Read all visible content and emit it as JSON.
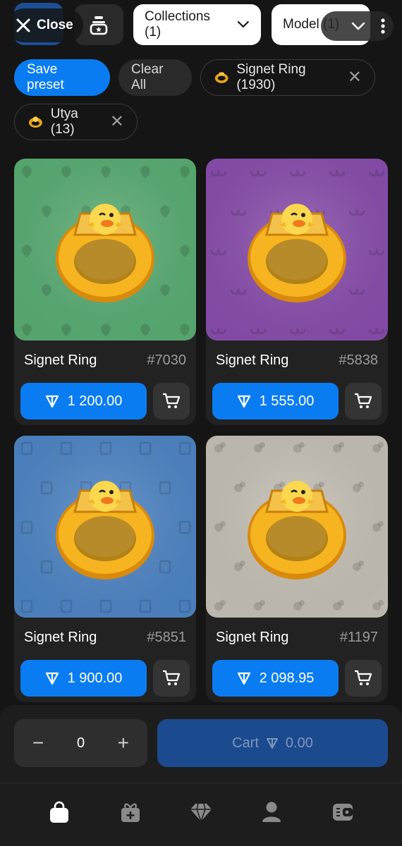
{
  "topbar": {
    "close_label": "Close",
    "collections_label": "Collections (1)",
    "model_label": "Model (1)"
  },
  "filters": {
    "save_preset": "Save preset",
    "clear_all": "Clear All",
    "chips": [
      {
        "label": "Signet Ring (1930)",
        "icon": "ring-icon"
      },
      {
        "label": "Utya (13)",
        "icon": "duck-icon"
      }
    ]
  },
  "cards": [
    {
      "name": "Signet Ring",
      "number": "#7030",
      "price": "1 200.00",
      "bg": "#5aae74",
      "pattern": "leaf"
    },
    {
      "name": "Signet Ring",
      "number": "#5838",
      "price": "1 555.00",
      "bg": "#8a4fae",
      "pattern": "mask"
    },
    {
      "name": "Signet Ring",
      "number": "#5851",
      "price": "1 900.00",
      "bg": "#4f86c6",
      "pattern": "box"
    },
    {
      "name": "Signet Ring",
      "number": "#1197",
      "price": "2 098.95",
      "bg": "#c7c2b7",
      "pattern": "flower"
    }
  ],
  "bottom": {
    "quantity": "0",
    "cart_label": "Cart",
    "cart_total": "0.00"
  },
  "nav": {
    "items": [
      "bag-icon",
      "gift-add-icon",
      "diamond-icon",
      "profile-icon",
      "wallet-icon"
    ]
  },
  "colors": {
    "accent": "#0a7cf2",
    "background": "#151515",
    "card": "#222222"
  }
}
